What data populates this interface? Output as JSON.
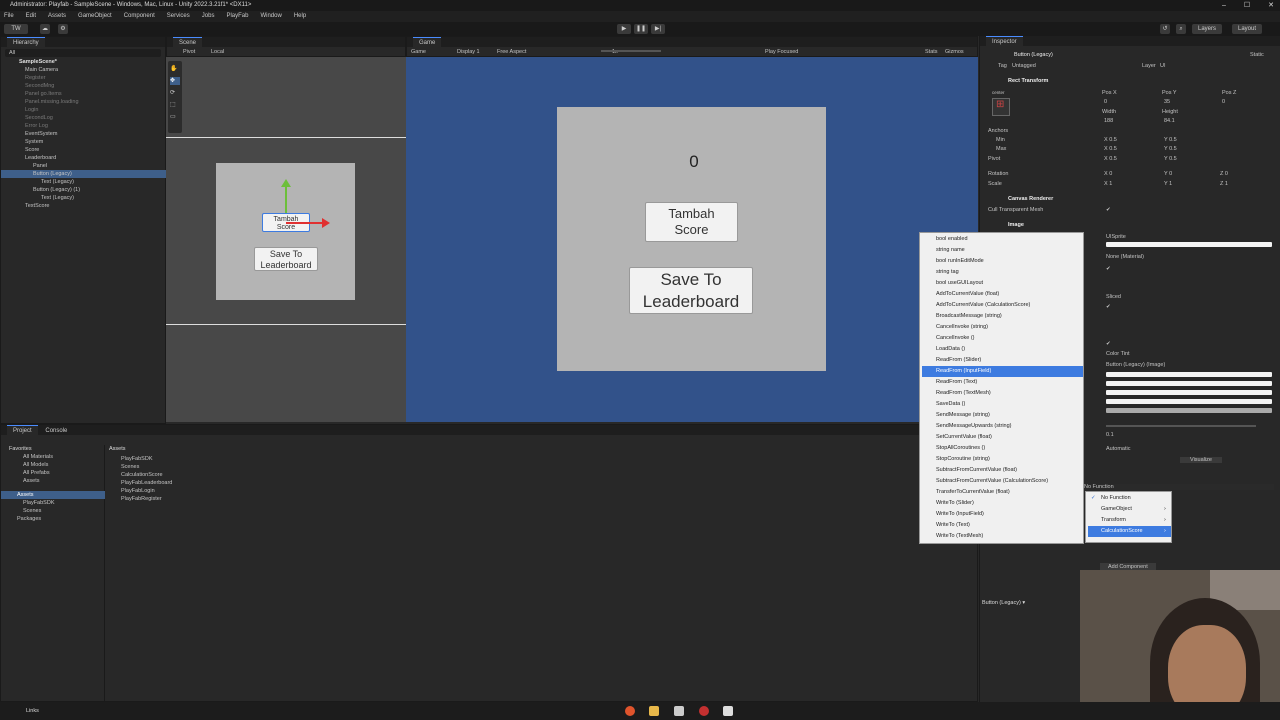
{
  "window": {
    "title": "Administrator: Playfab - SampleScene - Windows, Mac, Linux - Unity 2022.3.21f1* <DX11>"
  },
  "menu": [
    "File",
    "Edit",
    "Assets",
    "GameObject",
    "Component",
    "Services",
    "Jobs",
    "PlayFab",
    "Window",
    "Help"
  ],
  "toolbar": {
    "account": "TW",
    "layers": "Layers",
    "layout": "Layout"
  },
  "hierarchy": {
    "tab": "Hierarchy",
    "search": "All",
    "scene": "SampleScene*",
    "items": [
      {
        "label": "Main Camera",
        "dim": false
      },
      {
        "label": "Register",
        "dim": true
      },
      {
        "label": "SecondMng",
        "dim": true
      },
      {
        "label": "Panel go.Items",
        "dim": true
      },
      {
        "label": "Panel.missing.loading",
        "dim": true
      },
      {
        "label": "Login",
        "dim": true
      },
      {
        "label": "SecondLog",
        "dim": true
      },
      {
        "label": "Error Log",
        "dim": true
      },
      {
        "label": "EventSystem",
        "dim": false
      },
      {
        "label": "System",
        "dim": false
      },
      {
        "label": "Score",
        "dim": false
      },
      {
        "label": "Leaderboard",
        "dim": false
      },
      {
        "label": "Panel",
        "dim": false
      },
      {
        "label": "Button (Legacy)",
        "dim": false
      },
      {
        "label": "Text (Legacy)",
        "dim": false
      },
      {
        "label": "Button (Legacy) (1)",
        "dim": false
      },
      {
        "label": "Text (Legacy)",
        "dim": false
      },
      {
        "label": "TextScore",
        "dim": false
      }
    ]
  },
  "scene": {
    "tab": "Scene",
    "pivot": "Pivot",
    "local": "Local",
    "btn1": "Tambah\nScore",
    "btn2": "Save To\nLeaderboard"
  },
  "game": {
    "tab": "Game",
    "mode": "Game",
    "display": "Display 1",
    "aspect": "Free Aspect",
    "scale": "1x",
    "play": "Play Focused",
    "stats": "Stats",
    "gizmos": "Gizmos",
    "score": "0",
    "btn1": "Tambah\nScore",
    "btn2": "Save To\nLeaderboard"
  },
  "project": {
    "tab1": "Project",
    "tab2": "Console",
    "favorites": "Favorites",
    "fav_items": [
      "All Materials",
      "All Models",
      "All Prefabs",
      "Assets"
    ],
    "assets": "Assets",
    "asset_tree": [
      "PlayFabSDK",
      "Scenes"
    ],
    "packages": "Packages",
    "breadcrumb": "Assets",
    "files": [
      "PlayFabSDK",
      "Scenes",
      "CalculationScore",
      "PlayFabLeaderboard",
      "PlayFabLogin",
      "PlayFabRegister"
    ]
  },
  "context_menu": {
    "items": [
      "bool enabled",
      "string name",
      "bool runInEditMode",
      "string tag",
      "bool useGUILayout",
      "AddToCurrentValue (float)",
      "AddToCurrentValue (CalculationScore)",
      "BroadcastMessage (string)",
      "CancelInvoke (string)",
      "CancelInvoke ()",
      "LoadData ()",
      "ReadFrom (Slider)",
      "ReadFrom (InputField)",
      "ReadFrom (Text)",
      "ReadFrom (TextMesh)",
      "SaveData ()",
      "SendMessage (string)",
      "SendMessageUpwards (string)",
      "SetCurrentValue (float)",
      "StopAllCoroutines ()",
      "StopCoroutine (string)",
      "SubtractFromCurrentValue (float)",
      "SubtractFromCurrentValue (CalculationScore)",
      "TransferToCurrentValue (float)",
      "WriteTo (Slider)",
      "WriteTo (InputField)",
      "WriteTo (Text)",
      "WriteTo (TextMesh)"
    ],
    "highlighted": 12
  },
  "submenu": {
    "items": [
      "No Function",
      "GameObject",
      "Transform",
      "CalculationScore"
    ],
    "checked": 0,
    "highlighted": 3
  },
  "inspector": {
    "tab": "Inspector",
    "object": "Button (Legacy)",
    "static": "Static",
    "tag_label": "Tag",
    "tag": "Untagged",
    "layer_label": "Layer",
    "layer": "UI",
    "rect": "Rect Transform",
    "anchor_preset": "center",
    "posx_l": "Pos X",
    "posy_l": "Pos Y",
    "posz_l": "Pos Z",
    "posx": "0",
    "posy": "35",
    "posz": "0",
    "width_l": "Width",
    "height_l": "Height",
    "width": "188",
    "height": "84.1",
    "anchors": "Anchors",
    "min": "Min",
    "max": "Max",
    "pivot": "Pivot",
    "rotation": "Rotation",
    "scale": "Scale",
    "ax": "X 0.5",
    "ay": "Y 0.5",
    "rx": "X 0",
    "ry": "Y 0",
    "rz": "Z 0",
    "sx": "X 1",
    "sy": "Y 1",
    "sz": "Z 1",
    "canvas_renderer": "Canvas Renderer",
    "cull": "Cull Transparent Mesh",
    "image": "Image",
    "sprite": "UISprite",
    "material": "None (Material)",
    "sliced": "Sliced",
    "color_tint": "Color Tint",
    "target": "Button (Legacy) (Image)",
    "fade": "0.1",
    "nav": "Automatic",
    "visualize": "Visualize",
    "nofunc": "No Function",
    "add_component": "Add Component",
    "preview": "Button (Legacy) ▾"
  },
  "taskbar": {
    "left": "Links"
  },
  "colors": {
    "accent": "#3d7be0",
    "game_bg": "#32528a",
    "scene_bg": "#484848"
  }
}
